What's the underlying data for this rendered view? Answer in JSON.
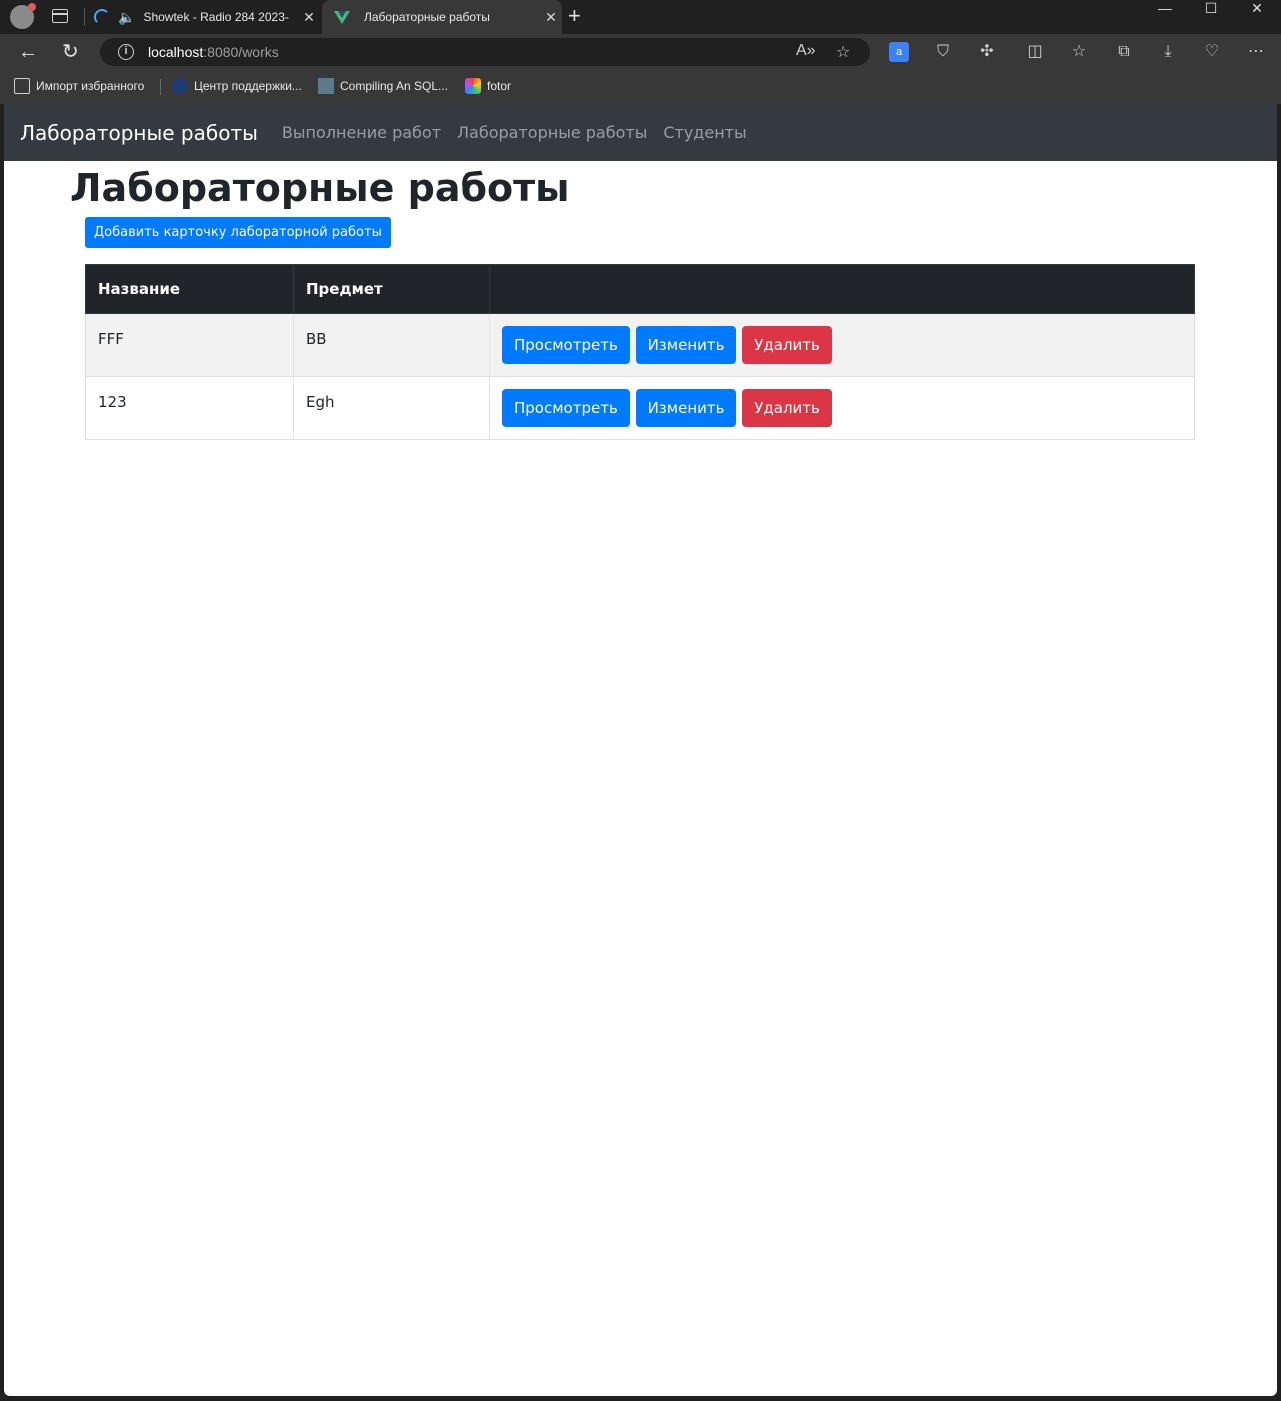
{
  "browser": {
    "tabs": [
      {
        "title": "Showtek - Radio 284 2023-"
      },
      {
        "title": "Лабораторные работы"
      }
    ],
    "url_host": "localhost",
    "url_rest": ":8080/works",
    "bookmarks": [
      {
        "label": "Импорт избранного",
        "icon": "folder-import-icon"
      },
      {
        "label": "Центр поддержки...",
        "icon": "support-icon"
      },
      {
        "label": "Compiling An SQL...",
        "icon": "sqlite-icon"
      },
      {
        "label": "fotor",
        "icon": "fotor-icon"
      }
    ]
  },
  "navbar": {
    "brand": "Лабораторные работы",
    "links": [
      "Выполнение работ",
      "Лабораторные работы",
      "Студенты"
    ]
  },
  "main": {
    "title": "Лабораторные работы",
    "add_button": "Добавить карточку лабораторной работы",
    "table": {
      "headers": [
        "Название",
        "Предмет",
        ""
      ],
      "rows": [
        {
          "name": "FFF",
          "subject": "BB"
        },
        {
          "name": "123",
          "subject": "Egh"
        }
      ],
      "actions": {
        "view": "Просмотреть",
        "edit": "Изменить",
        "delete": "Удалить"
      }
    }
  },
  "colors": {
    "primary": "#007bff",
    "danger": "#dc3545",
    "navbar": "#343a40",
    "table_header": "#212529"
  }
}
